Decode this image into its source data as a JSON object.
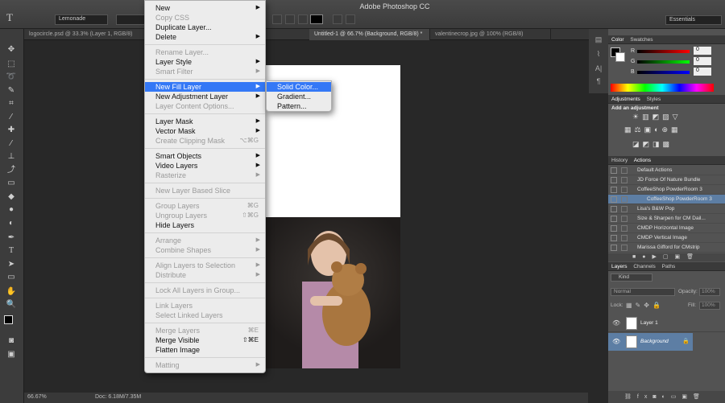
{
  "app_title": "Adobe Photoshop CC",
  "toolbar_options": {
    "tool_glyph": "T",
    "font_family": "Lemonade",
    "workspace": "Essentials"
  },
  "tabs": [
    "logocircle.psd @ 33.3% (Layer 1, RGB/8)",
    "Untitled-1 @ 66.7% (Background, RGB/8) *",
    "valentinecrop.jpg @ 100% (RGB/8)"
  ],
  "status": {
    "zoom": "66.67%",
    "doc": "Doc: 6.18M/7.35M"
  },
  "menu": {
    "items": [
      {
        "label": "New",
        "enabled": true,
        "submenu": true
      },
      {
        "label": "Copy CSS",
        "enabled": false
      },
      {
        "label": "Duplicate Layer...",
        "enabled": true
      },
      {
        "label": "Delete",
        "enabled": true,
        "submenu": true
      },
      {
        "sep": true
      },
      {
        "label": "Rename Layer...",
        "enabled": false
      },
      {
        "label": "Layer Style",
        "enabled": true,
        "submenu": true
      },
      {
        "label": "Smart Filter",
        "enabled": false,
        "submenu": true
      },
      {
        "sep": true
      },
      {
        "label": "New Fill Layer",
        "enabled": true,
        "submenu": true,
        "selected": true
      },
      {
        "label": "New Adjustment Layer",
        "enabled": true,
        "submenu": true
      },
      {
        "label": "Layer Content Options...",
        "enabled": false
      },
      {
        "sep": true
      },
      {
        "label": "Layer Mask",
        "enabled": true,
        "submenu": true
      },
      {
        "label": "Vector Mask",
        "enabled": true,
        "submenu": true
      },
      {
        "label": "Create Clipping Mask",
        "enabled": false,
        "shortcut": "⌥⌘G"
      },
      {
        "sep": true
      },
      {
        "label": "Smart Objects",
        "enabled": true,
        "submenu": true
      },
      {
        "label": "Video Layers",
        "enabled": true,
        "submenu": true
      },
      {
        "label": "Rasterize",
        "enabled": false,
        "submenu": true
      },
      {
        "sep": true
      },
      {
        "label": "New Layer Based Slice",
        "enabled": false
      },
      {
        "sep": true
      },
      {
        "label": "Group Layers",
        "enabled": false,
        "shortcut": "⌘G"
      },
      {
        "label": "Ungroup Layers",
        "enabled": false,
        "shortcut": "⇧⌘G"
      },
      {
        "label": "Hide Layers",
        "enabled": true
      },
      {
        "sep": true
      },
      {
        "label": "Arrange",
        "enabled": false,
        "submenu": true
      },
      {
        "label": "Combine Shapes",
        "enabled": false,
        "submenu": true
      },
      {
        "sep": true
      },
      {
        "label": "Align Layers to Selection",
        "enabled": false,
        "submenu": true
      },
      {
        "label": "Distribute",
        "enabled": false,
        "submenu": true
      },
      {
        "sep": true
      },
      {
        "label": "Lock All Layers in Group...",
        "enabled": false
      },
      {
        "sep": true
      },
      {
        "label": "Link Layers",
        "enabled": false
      },
      {
        "label": "Select Linked Layers",
        "enabled": false
      },
      {
        "sep": true
      },
      {
        "label": "Merge Layers",
        "enabled": false,
        "shortcut": "⌘E"
      },
      {
        "label": "Merge Visible",
        "enabled": true,
        "shortcut": "⇧⌘E"
      },
      {
        "label": "Flatten Image",
        "enabled": true
      },
      {
        "sep": true
      },
      {
        "label": "Matting",
        "enabled": false,
        "submenu": true
      }
    ]
  },
  "submenu": {
    "items": [
      {
        "label": "Solid Color...",
        "selected": true
      },
      {
        "label": "Gradient..."
      },
      {
        "label": "Pattern..."
      }
    ]
  },
  "color_panel": {
    "tabs": [
      "Color",
      "Swatches"
    ],
    "channels": [
      {
        "label": "R",
        "value": "0"
      },
      {
        "label": "G",
        "value": "0"
      },
      {
        "label": "B",
        "value": "0"
      }
    ]
  },
  "adjustments": {
    "tabs": [
      "Adjustments",
      "Styles"
    ],
    "header": "Add an adjustment"
  },
  "actions": {
    "tabs": [
      "History",
      "Actions"
    ],
    "items": [
      "Default Actions",
      "JD Force Of Nature Bundle",
      "CoffeeShop PowderRoom 3",
      "CoffeeShop PowderRoom 3",
      "Lisa's B&W Pop",
      "Size & Sharpen for CM Dail...",
      "CMDP Horizontal Image",
      "CMDP Vertical Image",
      "Marissa Gifford for CMstrip"
    ],
    "selected_index": 3
  },
  "layers": {
    "tabs": [
      "Layers",
      "Channels",
      "Paths"
    ],
    "kind": "Kind",
    "blend": "Normal",
    "opacity_label": "Opacity:",
    "opacity": "100%",
    "lock_label": "Lock:",
    "fill_label": "Fill:",
    "fill": "100%",
    "items": [
      {
        "name": "Layer 1",
        "selected": false
      },
      {
        "name": "Background",
        "selected": true
      }
    ]
  },
  "colors": {
    "menu_highlight": "#3478f6",
    "canvas": "#ffffff",
    "photo_bg": "#1f1c1b"
  }
}
